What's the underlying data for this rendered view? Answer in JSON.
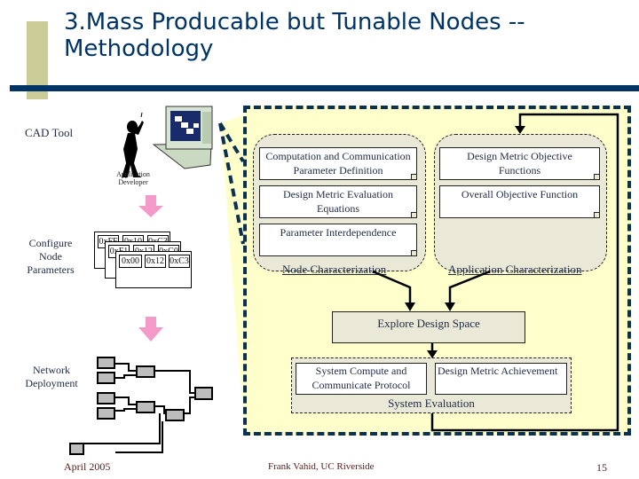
{
  "slide": {
    "title_line1": "3.Mass Producable but Tunable Nodes --",
    "title_line2": "Methodology"
  },
  "left": {
    "cad_tool_label": "CAD Tool",
    "developer_label_line1": "Application",
    "developer_label_line2": "Developer",
    "configure_label_line1": "Configure",
    "configure_label_line2": "Node",
    "configure_label_line3": "Parameters",
    "network_label_line1": "Network",
    "network_label_line2": "Deployment",
    "config_cards": [
      [
        "0xFF",
        "0x10",
        "0xC3"
      ],
      [
        "0xF1",
        "0x12",
        "0xC0"
      ],
      [
        "0x00",
        "0x12",
        "0xC3"
      ]
    ]
  },
  "methodology": {
    "node_characterization": {
      "label": "Node Characterization",
      "items": [
        {
          "line1": "Computation and Communication",
          "line2": "Parameter Definition"
        },
        {
          "line1": "Design Metric Evaluation",
          "line2": "Equations"
        },
        {
          "line1": "Parameter Interdependence",
          "line2": ""
        }
      ]
    },
    "application_characterization": {
      "label": "Application Characterization",
      "items": [
        {
          "line1": "Design Metric Objective",
          "line2": "Functions"
        },
        {
          "line1": "Overall Objective Function",
          "line2": ""
        }
      ]
    },
    "explore": "Explore Design Space",
    "system_evaluation": {
      "label": "System Evaluation",
      "items": [
        {
          "line1": "System Compute and",
          "line2": "Communicate Protocol"
        },
        {
          "line1": "Design Metric Achievement",
          "line2": ""
        }
      ]
    }
  },
  "footer": {
    "date": "April 2005",
    "author": "Frank Vahid, UC Riverside",
    "page": "15"
  },
  "colors": {
    "title": "#003366",
    "accent_bar": "#cccc99",
    "panel_fill": "#ffffcc",
    "panel_border": "#0b3152",
    "group_fill": "#eae8d6",
    "arrow_pink": "#f49ac9"
  }
}
